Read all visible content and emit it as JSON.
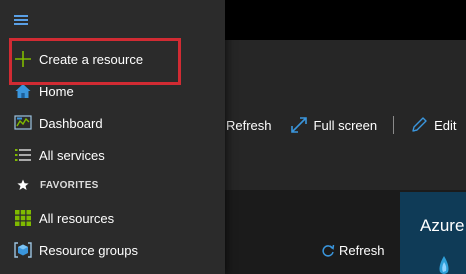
{
  "sidebar": {
    "menu_label": "Menu",
    "items": [
      {
        "label": "Create a resource",
        "icon": "plus-icon"
      },
      {
        "label": "Home",
        "icon": "home-icon"
      },
      {
        "label": "Dashboard",
        "icon": "dashboard-icon"
      },
      {
        "label": "All services",
        "icon": "list-icon"
      }
    ],
    "favorites_label": "FAVORITES",
    "favorites": [
      {
        "label": "All resources",
        "icon": "grid-icon"
      },
      {
        "label": "Resource groups",
        "icon": "resource-group-icon"
      }
    ]
  },
  "toolbar": {
    "refresh_label": "Refresh",
    "fullscreen_label": "Full screen",
    "edit_label": "Edit"
  },
  "tile": {
    "refresh_label": "Refresh",
    "azure_title": "Azure"
  },
  "colors": {
    "highlight": "#d12b33",
    "accent": "#5aa0e6",
    "plus": "#7fba00",
    "sidebar_bg": "#2b2b2b"
  }
}
